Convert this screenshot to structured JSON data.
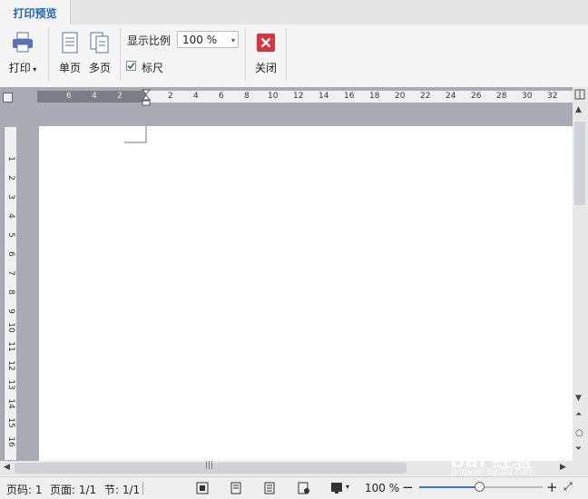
{
  "tab": {
    "label": "打印预览"
  },
  "ribbon": {
    "print_label": "打印",
    "single_page_label": "单页",
    "multi_page_label": "多页",
    "zoom_label": "显示比例",
    "zoom_value": "100 %",
    "ruler_label": "标尺",
    "ruler_checked": true,
    "close_label": "关闭"
  },
  "hruler": {
    "ticks_left": [
      "6",
      "4",
      "2"
    ],
    "ticks_right": [
      "2",
      "4",
      "6",
      "8",
      "10",
      "12",
      "14",
      "16",
      "18",
      "20",
      "22",
      "24",
      "26",
      "28",
      "30",
      "32"
    ]
  },
  "vruler": {
    "ticks": [
      "1",
      "2",
      "3",
      "4",
      "5",
      "6",
      "7",
      "8",
      "9",
      "10",
      "11",
      "12",
      "13",
      "14",
      "15",
      "16"
    ]
  },
  "status": {
    "page_code": "页码: 1",
    "page_count": "页面: 1/1",
    "section": "节: 1/1",
    "zoom_value": "100 %",
    "zoom_percent": 50
  },
  "watermark": {
    "text": "Bai 经验",
    "url": "jingyan.baidu.com"
  },
  "colors": {
    "accent": "#1f63b5",
    "close": "#d9333f",
    "workspace": "#a8abb4"
  }
}
